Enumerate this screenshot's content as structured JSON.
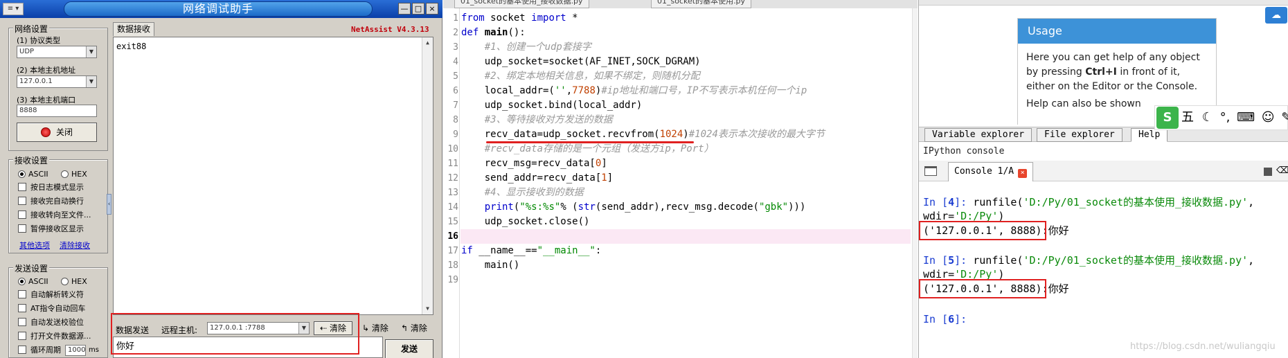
{
  "netassist": {
    "title": "网络调试助手",
    "version": "NetAssist V4.3.13",
    "titlebar_buttons": [
      "—",
      "□",
      "×"
    ],
    "net_settings": {
      "group_title": "网络设置",
      "protocol_label": "(1) 协议类型",
      "protocol_value": "UDP",
      "local_ip_label": "(2) 本地主机地址",
      "local_ip_value": "127.0.0.1",
      "local_port_label": "(3) 本地主机端口",
      "local_port_value": "8888",
      "close_button": "关闭"
    },
    "recv_settings": {
      "group_title": "接收设置",
      "ascii": "ASCII",
      "hex": "HEX",
      "options": [
        "按日志模式显示",
        "接收完自动换行",
        "接收转向至文件...",
        "暂停接收区显示"
      ],
      "link_more": "其他选项",
      "link_clear": "清除接收"
    },
    "send_settings": {
      "group_title": "发送设置",
      "ascii": "ASCII",
      "hex": "HEX",
      "options": [
        "自动解析转义符",
        "AT指令自动回车",
        "自动发送校验位",
        "打开文件数据源..."
      ],
      "cycle_label": "循环周期",
      "cycle_value": "1000",
      "cycle_unit": "ms"
    },
    "recv_tab": "数据接收",
    "recv_text": "exit88",
    "send_label": "数据发送",
    "remote_label": "远程主机:",
    "remote_value": "127.0.0.1 :7788",
    "clear_btn1": "清除",
    "clear_btn2": "清除",
    "clear_btn3": "清除",
    "send_text": "你好",
    "send_button": "发送"
  },
  "editor": {
    "tabs": [
      "01_socket的基本使用_接收数据.py",
      "01_socket的基本使用.py"
    ],
    "current_line": 16
  },
  "help": {
    "usage_title": "Usage",
    "usage_line1": "Here you can get help of any object",
    "usage_line2_pre": "by pressing ",
    "usage_line2_key": "Ctrl+I",
    "usage_line2_post": " in front of it,",
    "usage_line3": "either on the Editor or the Console.",
    "usage_line4": "Help can also be shown"
  },
  "panel_tabs": [
    "Variable explorer",
    "File explorer",
    "Help"
  ],
  "ipython": {
    "header": "IPython console",
    "console_tab": "Console 1/A",
    "in4": "In [4]: ",
    "in4_num": "4",
    "run4_a": "runfile(",
    "run4_path": "'D:/Py/01_socket的基本使用_接收数据.py'",
    "wdir": "wdir=",
    "wdir_path": "'D:/Py'",
    "out4": "('127.0.0.1', 8888):你好",
    "in5_num": "5",
    "out5": "('127.0.0.1', 8888):你好",
    "in6_num": "6"
  },
  "ime": {
    "logo": "S",
    "mode": "五"
  },
  "watermark": "https://blog.csdn.net/wuliangqiu",
  "colors": {
    "highlight_red": "#e02020",
    "spyder_blue": "#3d92d8",
    "titlebar_blue": "#0a3fa8"
  }
}
